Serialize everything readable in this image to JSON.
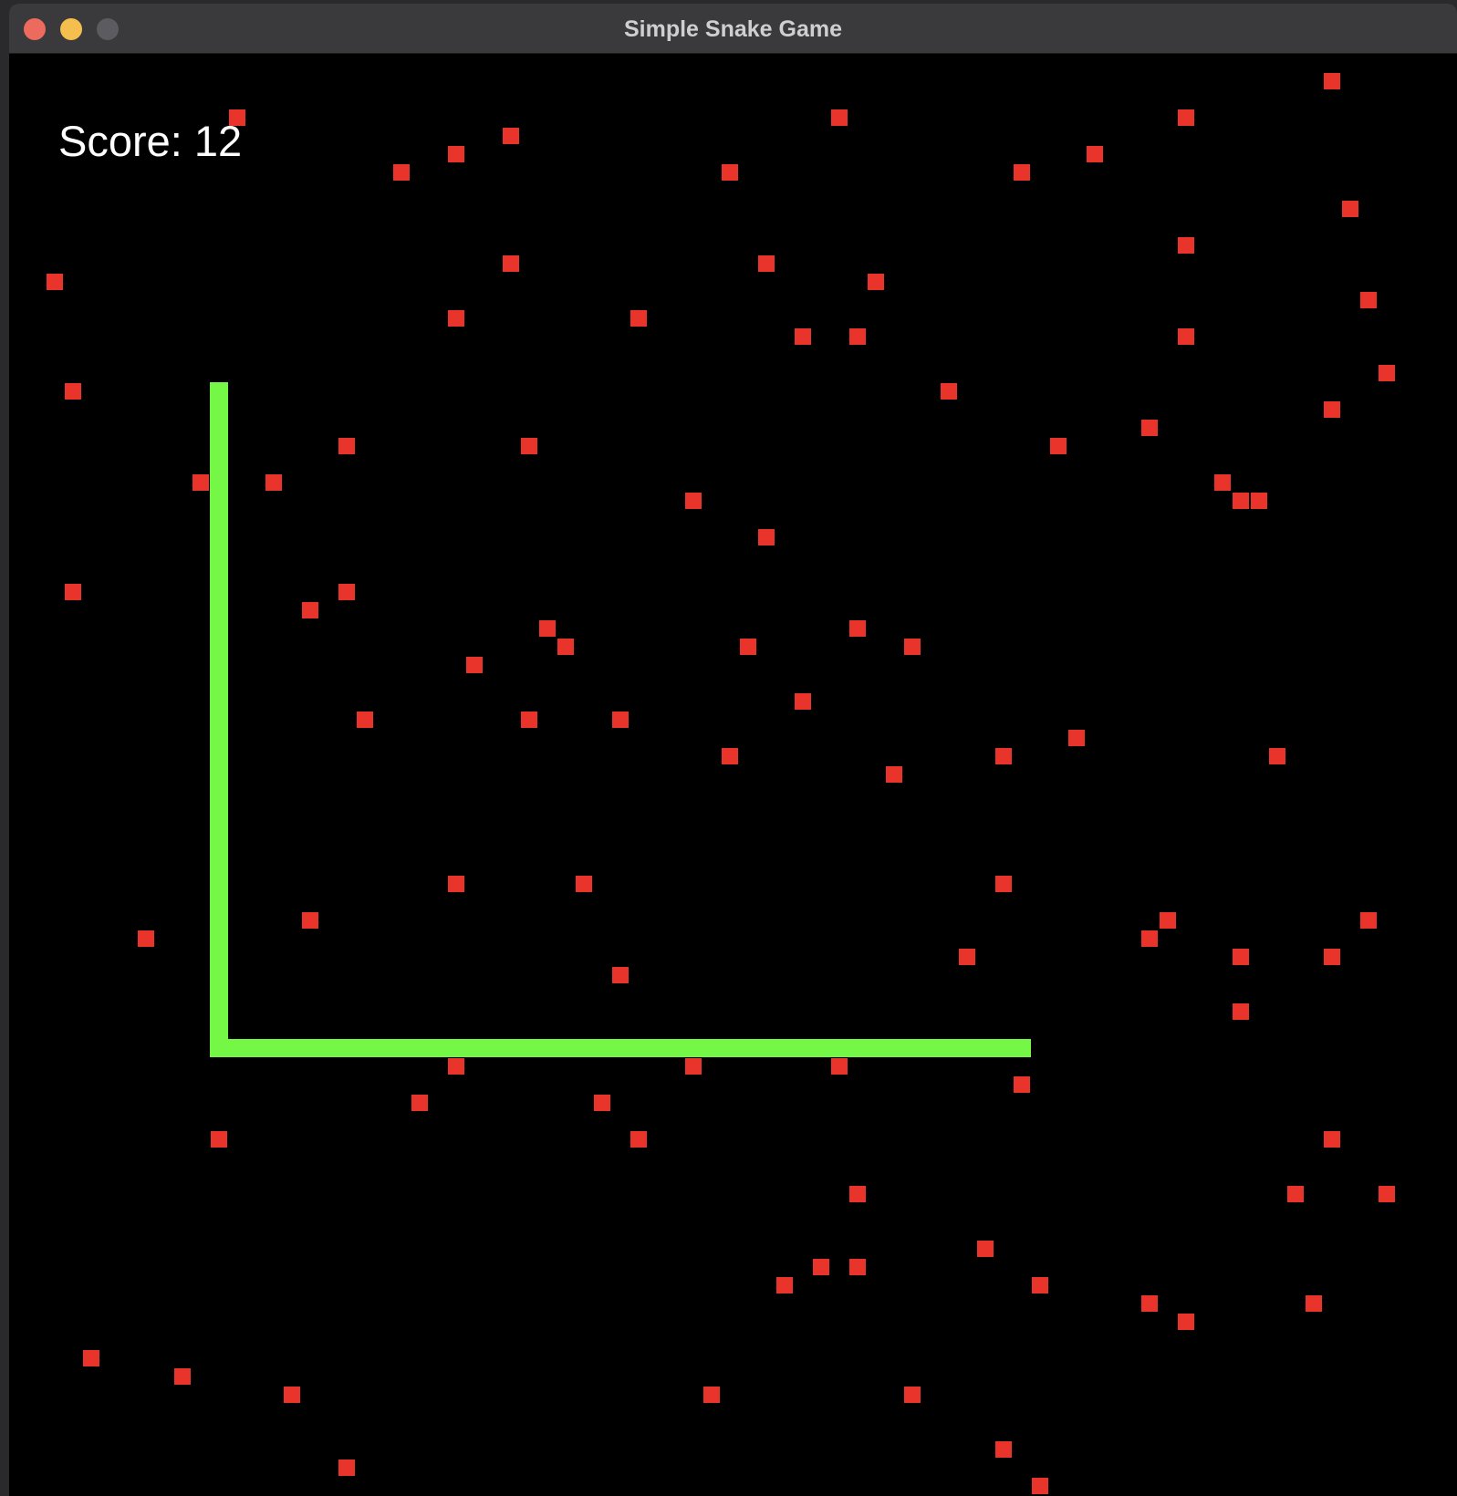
{
  "window": {
    "title": "Simple Snake Game"
  },
  "game": {
    "score_label": "Score: 12",
    "score": 12,
    "colors": {
      "background": "#000000",
      "snake": "#74f845",
      "food": "#e8342a",
      "score_text": "#ffffff"
    },
    "grid_cell_size": 20,
    "snake_body_cells": [
      [
        11,
        18
      ],
      [
        11,
        19
      ],
      [
        11,
        20
      ],
      [
        11,
        21
      ],
      [
        11,
        22
      ],
      [
        11,
        23
      ],
      [
        11,
        24
      ],
      [
        11,
        25
      ],
      [
        11,
        26
      ],
      [
        11,
        27
      ],
      [
        11,
        28
      ],
      [
        11,
        29
      ],
      [
        11,
        30
      ],
      [
        11,
        31
      ],
      [
        11,
        32
      ],
      [
        11,
        33
      ],
      [
        11,
        34
      ],
      [
        11,
        35
      ],
      [
        11,
        36
      ],
      [
        11,
        37
      ],
      [
        11,
        38
      ],
      [
        11,
        39
      ],
      [
        11,
        40
      ],
      [
        11,
        41
      ],
      [
        11,
        42
      ],
      [
        11,
        43
      ],
      [
        11,
        44
      ],
      [
        11,
        45
      ],
      [
        11,
        46
      ],
      [
        11,
        47
      ],
      [
        11,
        48
      ],
      [
        11,
        49
      ],
      [
        11,
        50
      ],
      [
        11,
        51
      ],
      [
        11,
        52
      ],
      [
        11,
        53
      ],
      [
        11,
        54
      ],
      [
        12,
        54
      ],
      [
        13,
        54
      ],
      [
        14,
        54
      ],
      [
        15,
        54
      ],
      [
        16,
        54
      ],
      [
        17,
        54
      ],
      [
        18,
        54
      ],
      [
        19,
        54
      ],
      [
        20,
        54
      ],
      [
        21,
        54
      ],
      [
        22,
        54
      ],
      [
        23,
        54
      ],
      [
        24,
        54
      ],
      [
        25,
        54
      ],
      [
        26,
        54
      ],
      [
        27,
        54
      ],
      [
        28,
        54
      ],
      [
        29,
        54
      ],
      [
        30,
        54
      ],
      [
        31,
        54
      ],
      [
        32,
        54
      ],
      [
        33,
        54
      ],
      [
        34,
        54
      ],
      [
        35,
        54
      ],
      [
        36,
        54
      ],
      [
        37,
        54
      ],
      [
        38,
        54
      ],
      [
        39,
        54
      ],
      [
        40,
        54
      ],
      [
        41,
        54
      ],
      [
        42,
        54
      ],
      [
        43,
        54
      ],
      [
        44,
        54
      ],
      [
        45,
        54
      ],
      [
        46,
        54
      ],
      [
        47,
        54
      ],
      [
        48,
        54
      ],
      [
        49,
        54
      ],
      [
        50,
        54
      ],
      [
        51,
        54
      ],
      [
        52,
        54
      ],
      [
        53,
        54
      ],
      [
        54,
        54
      ],
      [
        55,
        54
      ]
    ],
    "food_cells": [
      [
        72,
        1
      ],
      [
        12,
        3
      ],
      [
        45,
        3
      ],
      [
        64,
        3
      ],
      [
        27,
        4
      ],
      [
        24,
        5
      ],
      [
        59,
        5
      ],
      [
        21,
        6
      ],
      [
        39,
        6
      ],
      [
        55,
        6
      ],
      [
        73,
        8
      ],
      [
        64,
        10
      ],
      [
        27,
        11
      ],
      [
        41,
        11
      ],
      [
        2,
        12
      ],
      [
        47,
        12
      ],
      [
        74,
        13
      ],
      [
        24,
        14
      ],
      [
        34,
        14
      ],
      [
        43,
        15
      ],
      [
        46,
        15
      ],
      [
        64,
        15
      ],
      [
        75,
        17
      ],
      [
        3,
        18
      ],
      [
        51,
        18
      ],
      [
        72,
        19
      ],
      [
        62,
        20
      ],
      [
        18,
        21
      ],
      [
        28,
        21
      ],
      [
        57,
        21
      ],
      [
        10,
        23
      ],
      [
        14,
        23
      ],
      [
        66,
        23
      ],
      [
        67,
        24
      ],
      [
        68,
        24
      ],
      [
        37,
        24
      ],
      [
        41,
        26
      ],
      [
        3,
        29
      ],
      [
        18,
        29
      ],
      [
        16,
        30
      ],
      [
        29,
        31
      ],
      [
        30,
        32
      ],
      [
        40,
        32
      ],
      [
        49,
        32
      ],
      [
        46,
        31
      ],
      [
        25,
        33
      ],
      [
        43,
        35
      ],
      [
        19,
        36
      ],
      [
        28,
        36
      ],
      [
        33,
        36
      ],
      [
        58,
        37
      ],
      [
        39,
        38
      ],
      [
        54,
        38
      ],
      [
        69,
        38
      ],
      [
        48,
        39
      ],
      [
        24,
        45
      ],
      [
        31,
        45
      ],
      [
        54,
        45
      ],
      [
        7,
        48
      ],
      [
        16,
        47
      ],
      [
        63,
        47
      ],
      [
        74,
        47
      ],
      [
        62,
        48
      ],
      [
        52,
        49
      ],
      [
        67,
        49
      ],
      [
        72,
        49
      ],
      [
        33,
        50
      ],
      [
        67,
        52
      ],
      [
        24,
        55
      ],
      [
        37,
        55
      ],
      [
        45,
        55
      ],
      [
        55,
        56
      ],
      [
        22,
        57
      ],
      [
        32,
        57
      ],
      [
        11,
        59
      ],
      [
        34,
        59
      ],
      [
        72,
        59
      ],
      [
        46,
        62
      ],
      [
        70,
        62
      ],
      [
        75,
        62
      ],
      [
        53,
        65
      ],
      [
        44,
        66
      ],
      [
        46,
        66
      ],
      [
        42,
        67
      ],
      [
        56,
        67
      ],
      [
        62,
        68
      ],
      [
        71,
        68
      ],
      [
        64,
        69
      ],
      [
        4,
        71
      ],
      [
        9,
        72
      ],
      [
        15,
        73
      ],
      [
        38,
        73
      ],
      [
        49,
        73
      ],
      [
        54,
        76
      ],
      [
        18,
        77
      ],
      [
        56,
        78
      ],
      [
        17,
        79
      ],
      [
        24,
        79
      ]
    ]
  }
}
